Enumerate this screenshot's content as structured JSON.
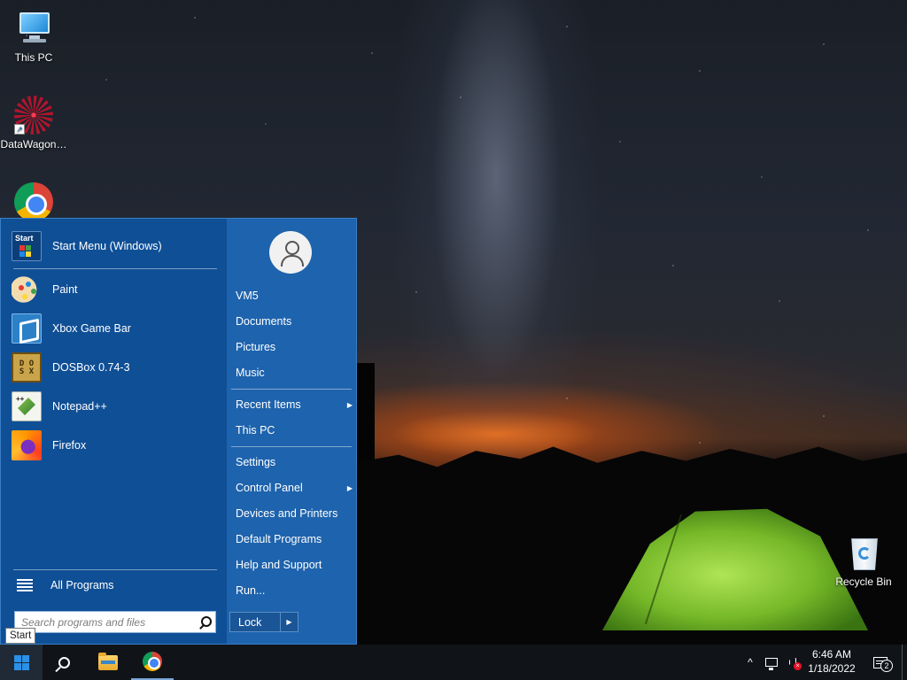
{
  "desktop": {
    "icons": {
      "this_pc": "This PC",
      "datawagon": "DataWagon…",
      "recycle_bin": "Recycle Bin"
    }
  },
  "start_menu": {
    "pinned": [
      {
        "label": "Start Menu (Windows)",
        "icon": "start-menu-icon"
      },
      {
        "label": "Paint",
        "icon": "paint-palette-icon"
      },
      {
        "label": "Xbox Game Bar",
        "icon": "xbox-game-bar-icon"
      },
      {
        "label": "DOSBox 0.74-3",
        "icon": "dosbox-icon"
      },
      {
        "label": "Notepad++",
        "icon": "notepad-plus-plus-icon"
      },
      {
        "label": "Firefox",
        "icon": "firefox-icon"
      }
    ],
    "all_programs": "All Programs",
    "search_placeholder": "Search programs and files",
    "right": {
      "user": "VM5",
      "documents": "Documents",
      "pictures": "Pictures",
      "music": "Music",
      "recent_items": "Recent Items",
      "this_pc": "This PC",
      "settings": "Settings",
      "control_panel": "Control Panel",
      "devices_printers": "Devices and Printers",
      "default_programs": "Default Programs",
      "help_support": "Help and Support",
      "run": "Run...",
      "lock": "Lock"
    },
    "submenu_arrow": "▶"
  },
  "tooltip": "Start",
  "taskbar": {
    "time": "6:46 AM",
    "date": "1/18/2022",
    "notification_count": "2",
    "tray_chevron": "^",
    "volume_muted_mark": "×"
  },
  "colors": {
    "start_menu_left": "#0f4f96",
    "start_menu_right": "#1e63ad",
    "taskbar": "#101419",
    "accent": "#2b90e8"
  }
}
